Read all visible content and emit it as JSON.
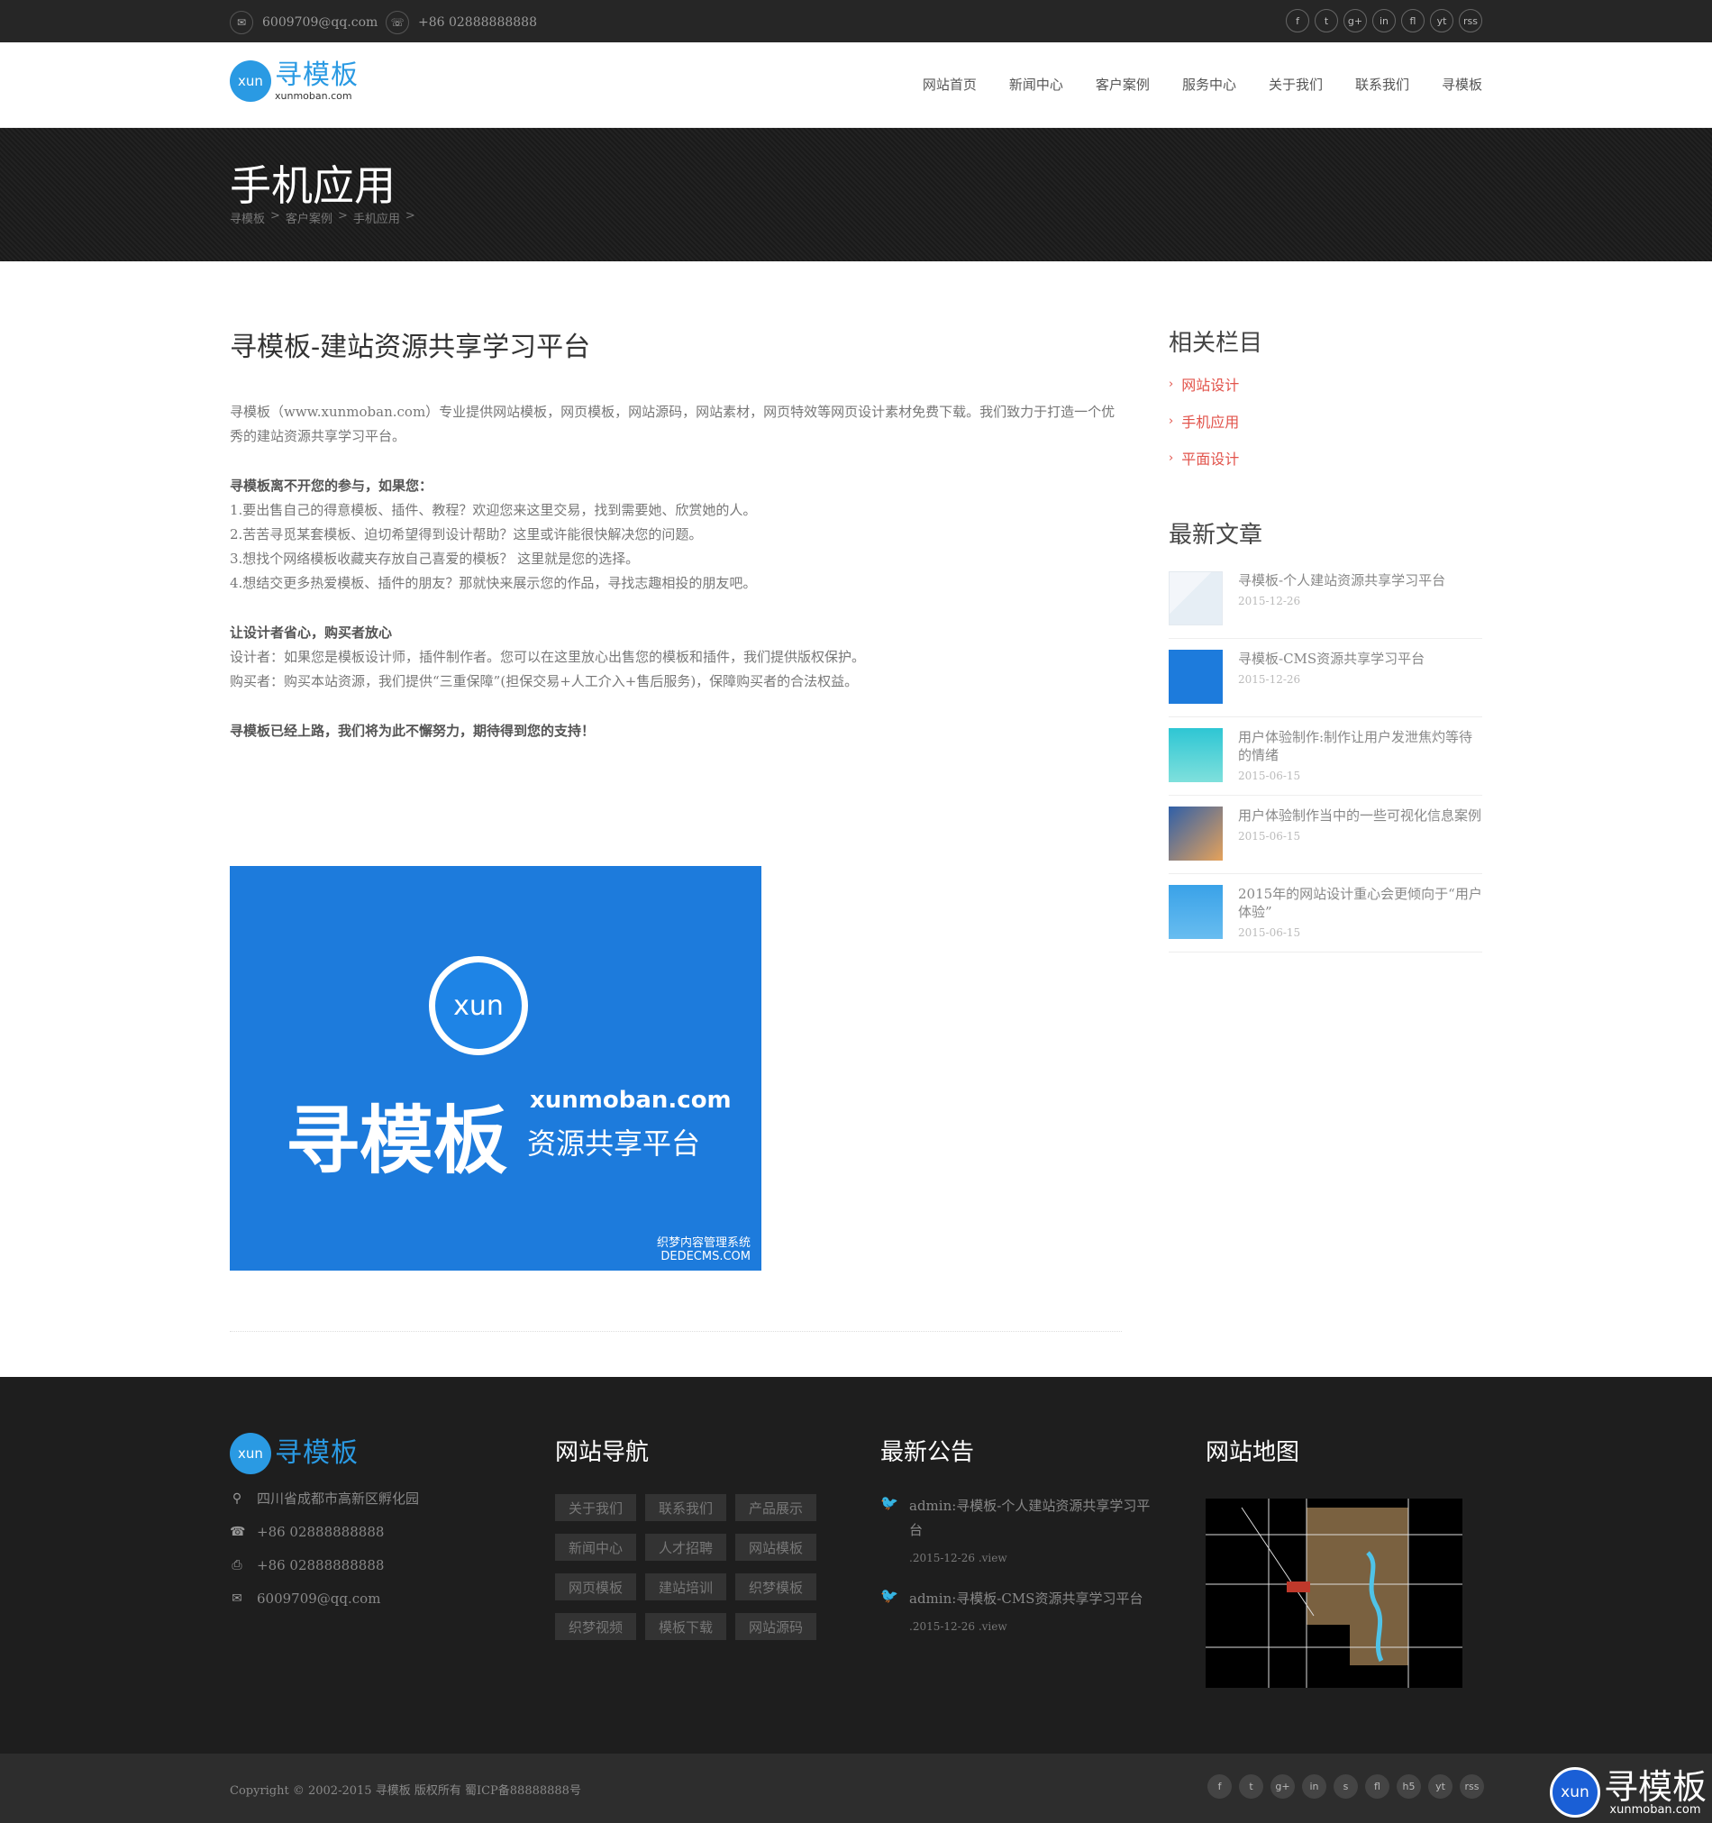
{
  "topbar": {
    "email": "6009709@qq.com",
    "phone": "+86 02888888888",
    "social": [
      "f",
      "t",
      "g+",
      "in",
      "fl",
      "yt",
      "rss"
    ]
  },
  "header": {
    "logo_bubble": "xun",
    "logo_cn": "寻模板",
    "logo_en": "xunmoban.com",
    "nav": [
      "网站首页",
      "新闻中心",
      "客户案例",
      "服务中心",
      "关于我们",
      "联系我们",
      "寻模板"
    ]
  },
  "banner": {
    "title": "手机应用",
    "breadcrumb": [
      "寻模板",
      ">",
      "客户案例",
      ">",
      "手机应用",
      ">"
    ]
  },
  "article": {
    "title": "寻模板-建站资源共享学习平台",
    "intro": "寻模板（www.xunmoban.com）专业提供网站模板，网页模板，网站源码，网站素材，网页特效等网页设计素材免费下载。我们致力于打造一个优秀的建站资源共享学习平台。",
    "sec1_title": "寻模板离不开您的参与，如果您：",
    "sec1_items": [
      "1.要出售自己的得意模板、插件、教程？欢迎您来这里交易，找到需要她、欣赏她的人。",
      "2.苦苦寻觅某套模板、迫切希望得到设计帮助？这里或许能很快解决您的问题。",
      "3.想找个网络模板收藏夹存放自己喜爱的模板？  这里就是您的选择。",
      "4.想结交更多热爱模板、插件的朋友？那就快来展示您的作品，寻找志趣相投的朋友吧。"
    ],
    "sec2_title": "让设计者省心，购买者放心",
    "sec2_items": [
      "设计者：如果您是模板设计师，插件制作者。您可以在这里放心出售您的模板和插件，我们提供版权保护。",
      "购买者：购买本站资源，我们提供“三重保障”(担保交易+人工介入+售后服务)，保障购买者的合法权益。"
    ],
    "closing": "寻模板已经上路，我们将为此不懈努力，期待得到您的支持！",
    "hero": {
      "bubble": "xun",
      "big": "寻模板",
      "url": "xunmoban.com",
      "sub": "资源共享平台",
      "stamp1": "织梦内容管理系统",
      "stamp2": "DEDECMS.COM"
    }
  },
  "sidebar": {
    "related_title": "相关栏目",
    "categories": [
      "网站设计",
      "手机应用",
      "平面设计"
    ],
    "latest_title": "最新文章",
    "posts": [
      {
        "title": "寻模板-个人建站资源共享学习平台",
        "date": "2015-12-26"
      },
      {
        "title": "寻模板-CMS资源共享学习平台",
        "date": "2015-12-26"
      },
      {
        "title": "用户体验制作:制作让用户发泄焦灼等待的情绪",
        "date": "2015-06-15"
      },
      {
        "title": "用户体验制作当中的一些可视化信息案例",
        "date": "2015-06-15"
      },
      {
        "title": "2015年的网站设计重心会更倾向于“用户体验”",
        "date": "2015-06-15"
      }
    ]
  },
  "footer": {
    "logo_bubble": "xun",
    "logo_cn": "寻模板",
    "address": "四川省成都市高新区孵化园",
    "phone": "+86 02888888888",
    "fax": "+86 02888888888",
    "email": "6009709@qq.com",
    "nav_title": "网站导航",
    "nav_tags": [
      "关于我们",
      "联系我们",
      "产品展示",
      "新闻中心",
      "人才招聘",
      "网站模板",
      "网页模板",
      "建站培训",
      "织梦模板",
      "织梦视频",
      "模板下载",
      "网站源码"
    ],
    "notice_title": "最新公告",
    "notices": [
      {
        "text": "admin:寻模板-个人建站资源共享学习平台",
        "meta": ".2015-12-26 .view"
      },
      {
        "text": "admin:寻模板-CMS资源共享学习平台",
        "meta": ".2015-12-26 .view"
      }
    ],
    "map_title": "网站地图",
    "copyright": "Copyright © 2002-2015 寻模板 版权所有  蜀ICP备88888888号",
    "social": [
      "f",
      "t",
      "g+",
      "in",
      "s",
      "fl",
      "h5",
      "yt",
      "rss"
    ],
    "watermark_bubble": "xun",
    "watermark_cn": "寻模板",
    "watermark_en": "xunmoban.com"
  }
}
